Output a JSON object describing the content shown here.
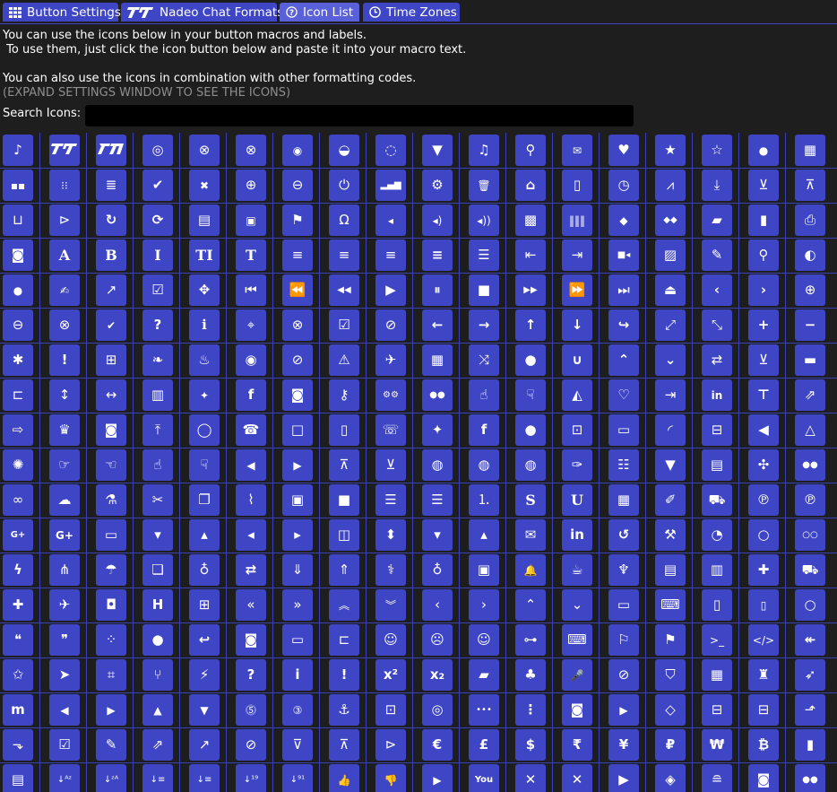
{
  "tabs": [
    {
      "label": "Button Settings",
      "icon": "grid-icon"
    },
    {
      "label": "Nadeo Chat Formats",
      "icon": "trackmania-logo-icon"
    },
    {
      "label": "Icon List",
      "icon": "question-circle-icon",
      "active": true
    },
    {
      "label": "Time Zones",
      "icon": "clock-icon"
    }
  ],
  "intro": {
    "line1": "You can use the icons below in your button macros and labels.",
    "line2": " To use them, just click the icon button below and paste it into your macro text.",
    "line3": "You can also use the icons in combination with other formatting codes.",
    "line4": "(EXPAND SETTINGS WINDOW TO SEE THE ICONS)"
  },
  "search": {
    "label": "Search Icons:",
    "value": "",
    "placeholder": ""
  },
  "colors": {
    "accent": "#3f46c5",
    "background": "#1e1e1e",
    "muted_text": "#8f8f8f"
  },
  "icons": [
    [
      "tiktok",
      "trackmania-logo",
      "trackmania-logo-alt",
      "spiral",
      "xbox",
      "xbox",
      "ubisoft",
      "xbox-logo",
      "globe-outline",
      "filter",
      "music",
      "search",
      "envelope-outline",
      "heart",
      "star",
      "star-outline",
      "user",
      "film"
    ],
    [
      "th-large",
      "th",
      "th-list",
      "check",
      "times",
      "search-plus",
      "search-minus",
      "power-off",
      "signal",
      "cog",
      "trash",
      "home",
      "file-outline",
      "clock",
      "road",
      "download",
      "arrow-circle-down",
      "arrow-circle-up"
    ],
    [
      "inbox",
      "play-circle",
      "repeat",
      "refresh",
      "list-alt",
      "lock",
      "flag",
      "headphones",
      "volume-off",
      "volume-down",
      "volume-up",
      "qrcode",
      "barcode",
      "tag",
      "tags",
      "book",
      "bookmark",
      "print"
    ],
    [
      "camera",
      "font",
      "bold",
      "italic",
      "text-height",
      "text-width",
      "align-left",
      "align-center",
      "align-right",
      "align-justify",
      "list",
      "outdent",
      "indent",
      "video",
      "image",
      "pencil",
      "map-marker",
      "adjust"
    ],
    [
      "tint",
      "edit",
      "share-square",
      "check-square",
      "arrows",
      "step-backward",
      "fast-backward",
      "backward",
      "play",
      "pause",
      "stop",
      "forward",
      "fast-forward",
      "step-forward",
      "eject",
      "chevron-left",
      "chevron-right",
      "plus-circle"
    ],
    [
      "minus-circle",
      "times-circle",
      "check-circle",
      "question-circle",
      "info-circle",
      "crosshairs",
      "times-circle-outline",
      "check-circle-outline",
      "ban",
      "arrow-left",
      "arrow-right",
      "arrow-up",
      "arrow-down",
      "share",
      "expand",
      "compress",
      "plus",
      "minus"
    ],
    [
      "asterisk",
      "exclamation-circle",
      "gift",
      "leaf",
      "fire",
      "eye",
      "eye-slash",
      "warning",
      "plane",
      "calendar",
      "random",
      "comment",
      "magnet",
      "chevron-up",
      "chevron-down",
      "retweet",
      "shopping-cart",
      "folder"
    ],
    [
      "folder-open",
      "arrows-v",
      "arrows-h",
      "bar-chart",
      "twitter-square",
      "facebook-square",
      "camera-retro",
      "key",
      "cogs",
      "comments",
      "thumbs-up-outline",
      "thumbs-down-outline",
      "star-half",
      "heart-outline",
      "sign-out",
      "linkedin-square",
      "thumb-tack",
      "external-link"
    ],
    [
      "sign-in",
      "trophy",
      "github-square",
      "upload",
      "lemon",
      "phone",
      "square-outline",
      "bookmark-outline",
      "phone-square",
      "twitter",
      "facebook",
      "github",
      "unlock",
      "credit-card",
      "rss",
      "hdd",
      "bullhorn",
      "bell-outline"
    ],
    [
      "certificate",
      "hand-right",
      "hand-left",
      "hand-up",
      "hand-down",
      "arrow-circle-left",
      "arrow-circle-right",
      "arrow-circle-up",
      "arrow-circle-down",
      "globe",
      "globe-2",
      "globe-3",
      "wrench",
      "tasks",
      "funnel",
      "briefcase",
      "arrows-alt",
      "users"
    ],
    [
      "link",
      "cloud",
      "flask",
      "scissors",
      "copy",
      "paperclip",
      "floppy",
      "square",
      "bars",
      "list-ul",
      "list-ol",
      "strikethrough",
      "underline",
      "table",
      "magic",
      "truck",
      "pinterest",
      "pinterest-square"
    ],
    [
      "google-plus-square",
      "google-plus",
      "money",
      "caret-down",
      "caret-up",
      "caret-left",
      "caret-right",
      "columns",
      "sort",
      "sort-desc",
      "sort-asc",
      "envelope",
      "linkedin",
      "undo",
      "gavel",
      "dashboard",
      "comment-outline",
      "comments-outline"
    ],
    [
      "bolt",
      "sitemap",
      "umbrella",
      "paste",
      "lightbulb",
      "exchange",
      "cloud-download",
      "cloud-upload",
      "user-md",
      "stethoscope",
      "suitcase",
      "bell",
      "coffee",
      "cutlery",
      "file-text-outline",
      "building",
      "hospital",
      "ambulance"
    ],
    [
      "medkit",
      "fighter-jet",
      "beer",
      "h-square",
      "plus-square",
      "angle-double-left",
      "angle-double-right",
      "angle-double-up",
      "angle-double-down",
      "angle-left",
      "angle-right",
      "angle-up",
      "angle-down",
      "desktop",
      "laptop",
      "tablet",
      "mobile",
      "circle-outline"
    ],
    [
      "quote-left",
      "quote-right",
      "spinner",
      "circle",
      "reply",
      "github-alt",
      "folder-outline",
      "folder-open-outline",
      "smile",
      "frown",
      "meh",
      "gamepad",
      "keyboard",
      "flag-outline",
      "flag-checkered",
      "terminal",
      "code",
      "reply-all"
    ],
    [
      "star-half-outline",
      "location-arrow",
      "crop",
      "code-fork",
      "chain-broken",
      "question",
      "info",
      "exclamation",
      "superscript",
      "subscript",
      "eraser",
      "puzzle-piece",
      "microphone",
      "microphone-slash",
      "shield",
      "calendar-outline",
      "fire-extinguisher",
      "rocket"
    ],
    [
      "maxcdn",
      "chevron-circle-left",
      "chevron-circle-right",
      "chevron-circle-up",
      "chevron-circle-down",
      "html5",
      "css3",
      "anchor",
      "unlock-alt",
      "bullseye",
      "ellipsis-h",
      "ellipsis-v",
      "rss-square",
      "play-circle-2",
      "ticket",
      "minus-square",
      "minus-square-outline",
      "level-up"
    ],
    [
      "level-down",
      "check-square-2",
      "pencil-square",
      "external-link-square",
      "share-square-2",
      "compass",
      "caret-square-down",
      "caret-square-up",
      "caret-square-right",
      "euro",
      "gbp",
      "dollar",
      "rupee",
      "yen",
      "ruble",
      "won",
      "bitcoin",
      "file"
    ],
    [
      "file-text",
      "sort-alpha-asc",
      "sort-alpha-desc",
      "sort-amount-asc",
      "sort-amount-desc",
      "sort-numeric-asc",
      "sort-numeric-desc",
      "thumbs-up",
      "thumbs-down",
      "youtube-square",
      "youtube",
      "xing",
      "xing-square",
      "youtube-play",
      "dropbox",
      "stack-overflow",
      "instagram",
      "flickr"
    ]
  ]
}
